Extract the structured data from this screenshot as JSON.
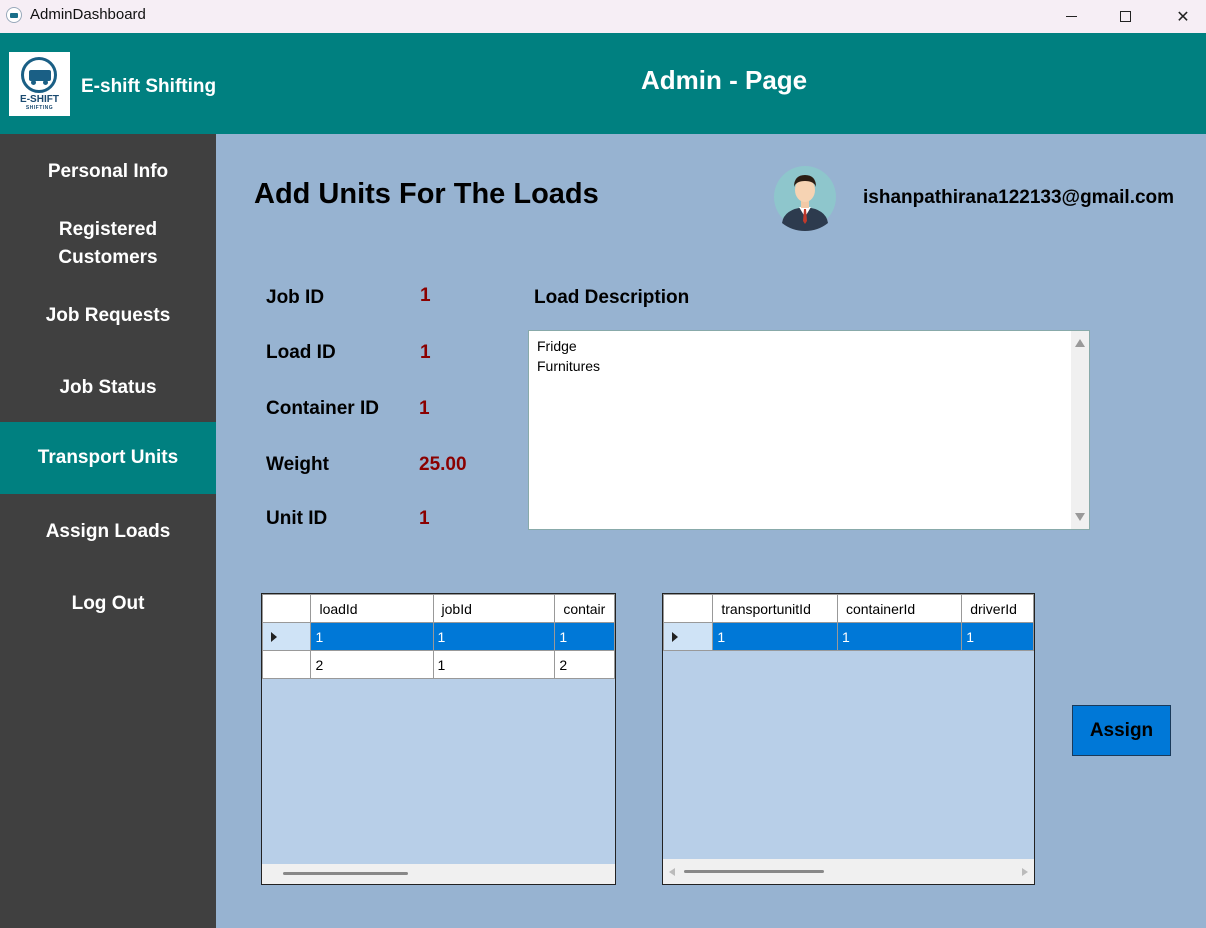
{
  "window": {
    "title": "AdminDashboard",
    "minimize_icon": "minimize-icon",
    "maximize_icon": "maximize-icon",
    "close_icon": "close-icon",
    "close_glyph": "✕"
  },
  "header": {
    "logo_text": "E-SHIFT",
    "logo_subtext": "SHIFTING",
    "brand": "E-shift Shifting",
    "page_title": "Admin - Page",
    "color": "#008080"
  },
  "sidebar": {
    "items": [
      {
        "label": "Personal Info",
        "active": false
      },
      {
        "label": "Registered Customers",
        "active": false
      },
      {
        "label": "Job Requests",
        "active": false
      },
      {
        "label": "Job Status",
        "active": false
      },
      {
        "label": "Transport Units",
        "active": true
      },
      {
        "label": "Assign Loads",
        "active": false
      },
      {
        "label": "Log Out",
        "active": false
      }
    ]
  },
  "main": {
    "heading": "Add Units For The Loads",
    "user_email": "ishanpathirana122133@gmail.com",
    "fields": {
      "job_id": {
        "label": "Job ID",
        "value": "1"
      },
      "load_id": {
        "label": "Load ID",
        "value": "1"
      },
      "container_id": {
        "label": "Container ID",
        "value": "1"
      },
      "weight": {
        "label": "Weight",
        "value": "25.00"
      },
      "unit_id": {
        "label": "Unit ID",
        "value": "1"
      }
    },
    "load_description": {
      "label": "Load Description",
      "lines": [
        "Fridge",
        "Furnitures"
      ]
    },
    "loads_grid": {
      "columns": [
        "loadId",
        "jobId",
        "contair"
      ],
      "rows": [
        {
          "selected": true,
          "cells": [
            "1",
            "1",
            "1"
          ]
        },
        {
          "selected": false,
          "cells": [
            "2",
            "1",
            "2"
          ]
        }
      ]
    },
    "units_grid": {
      "columns": [
        "transportunitId",
        "containerId",
        "driverId"
      ],
      "rows": [
        {
          "selected": true,
          "cells": [
            "1",
            "1",
            "1"
          ]
        }
      ]
    },
    "assign_button": "Assign"
  }
}
